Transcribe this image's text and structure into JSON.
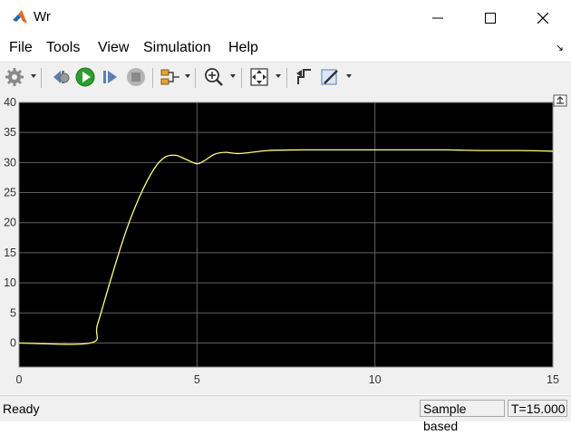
{
  "window": {
    "title": "Wr",
    "icon": "matlab-icon",
    "controls": [
      "minimize-icon",
      "maximize-icon",
      "close-icon"
    ]
  },
  "menu": {
    "items": [
      "File",
      "Tools",
      "View",
      "Simulation",
      "Help"
    ],
    "overflow_icon": "undock-arrow-icon"
  },
  "toolbar": {
    "icons": [
      "gear-icon",
      "step-back-icon",
      "run-icon",
      "step-forward-icon",
      "stop-icon",
      "signal-selector-icon",
      "zoom-in-icon",
      "autoscale-icon",
      "cursor-measurements-icon",
      "style-icon"
    ]
  },
  "chart_data": {
    "type": "line",
    "background": "#000000",
    "grid": true,
    "grid_color": "#5f5f5f",
    "axis_color": "#e6e6e6",
    "xlim": [
      0,
      15
    ],
    "ylim": [
      -4,
      40
    ],
    "xticks": [
      0,
      5,
      10,
      15
    ],
    "yticks": [
      0,
      5,
      10,
      15,
      20,
      25,
      30,
      35,
      40
    ],
    "series": [
      {
        "color": "#ffff80",
        "x": [
          0,
          2.0,
          2.2,
          2.6,
          3.0,
          3.4,
          3.8,
          4.1,
          4.4,
          4.7,
          5.0,
          5.2,
          5.5,
          5.8,
          6.2,
          7.0,
          8.0,
          9.0,
          10.0,
          11.0,
          12.0,
          13.0,
          14.0,
          15.0
        ],
        "y": [
          0,
          0,
          3.0,
          11.0,
          18.5,
          24.5,
          29.0,
          30.9,
          31.2,
          30.5,
          29.8,
          30.3,
          31.4,
          31.7,
          31.5,
          32.0,
          32.1,
          32.1,
          32.1,
          32.1,
          32.1,
          32.0,
          32.0,
          31.9
        ]
      }
    ]
  },
  "status": {
    "state": "Ready",
    "sample_mode": "Sample based",
    "time": "T=15.000"
  }
}
